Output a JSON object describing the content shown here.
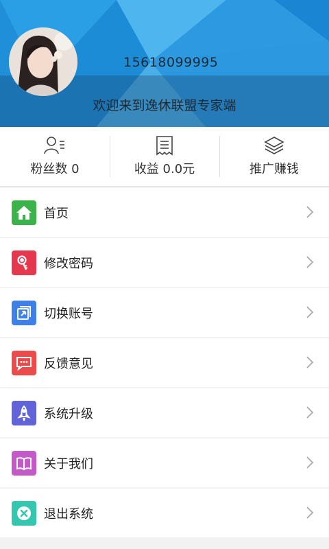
{
  "profile": {
    "phone": "15618099995",
    "welcome": "欢迎来到逸休联盟专家端"
  },
  "stats": [
    {
      "label": "粉丝数 0",
      "icon": "user-list-icon"
    },
    {
      "label": "收益 0.0元",
      "icon": "receipt-icon"
    },
    {
      "label": "推广赚钱",
      "icon": "layers-icon"
    }
  ],
  "menu": [
    {
      "label": "首页",
      "icon": "home-icon",
      "color": "#3bb24a"
    },
    {
      "label": "修改密码",
      "icon": "key-icon",
      "color": "#e5384f"
    },
    {
      "label": "切换账号",
      "icon": "switch-account-icon",
      "color": "#3f7fe8"
    },
    {
      "label": "反馈意见",
      "icon": "chat-icon",
      "color": "#ec4b4b"
    },
    {
      "label": "系统升级",
      "icon": "rocket-icon",
      "color": "#6164d9"
    },
    {
      "label": "关于我们",
      "icon": "book-icon",
      "color": "#c35ac7"
    },
    {
      "label": "退出系统",
      "icon": "close-circle-icon",
      "color": "#35c6b0"
    }
  ]
}
